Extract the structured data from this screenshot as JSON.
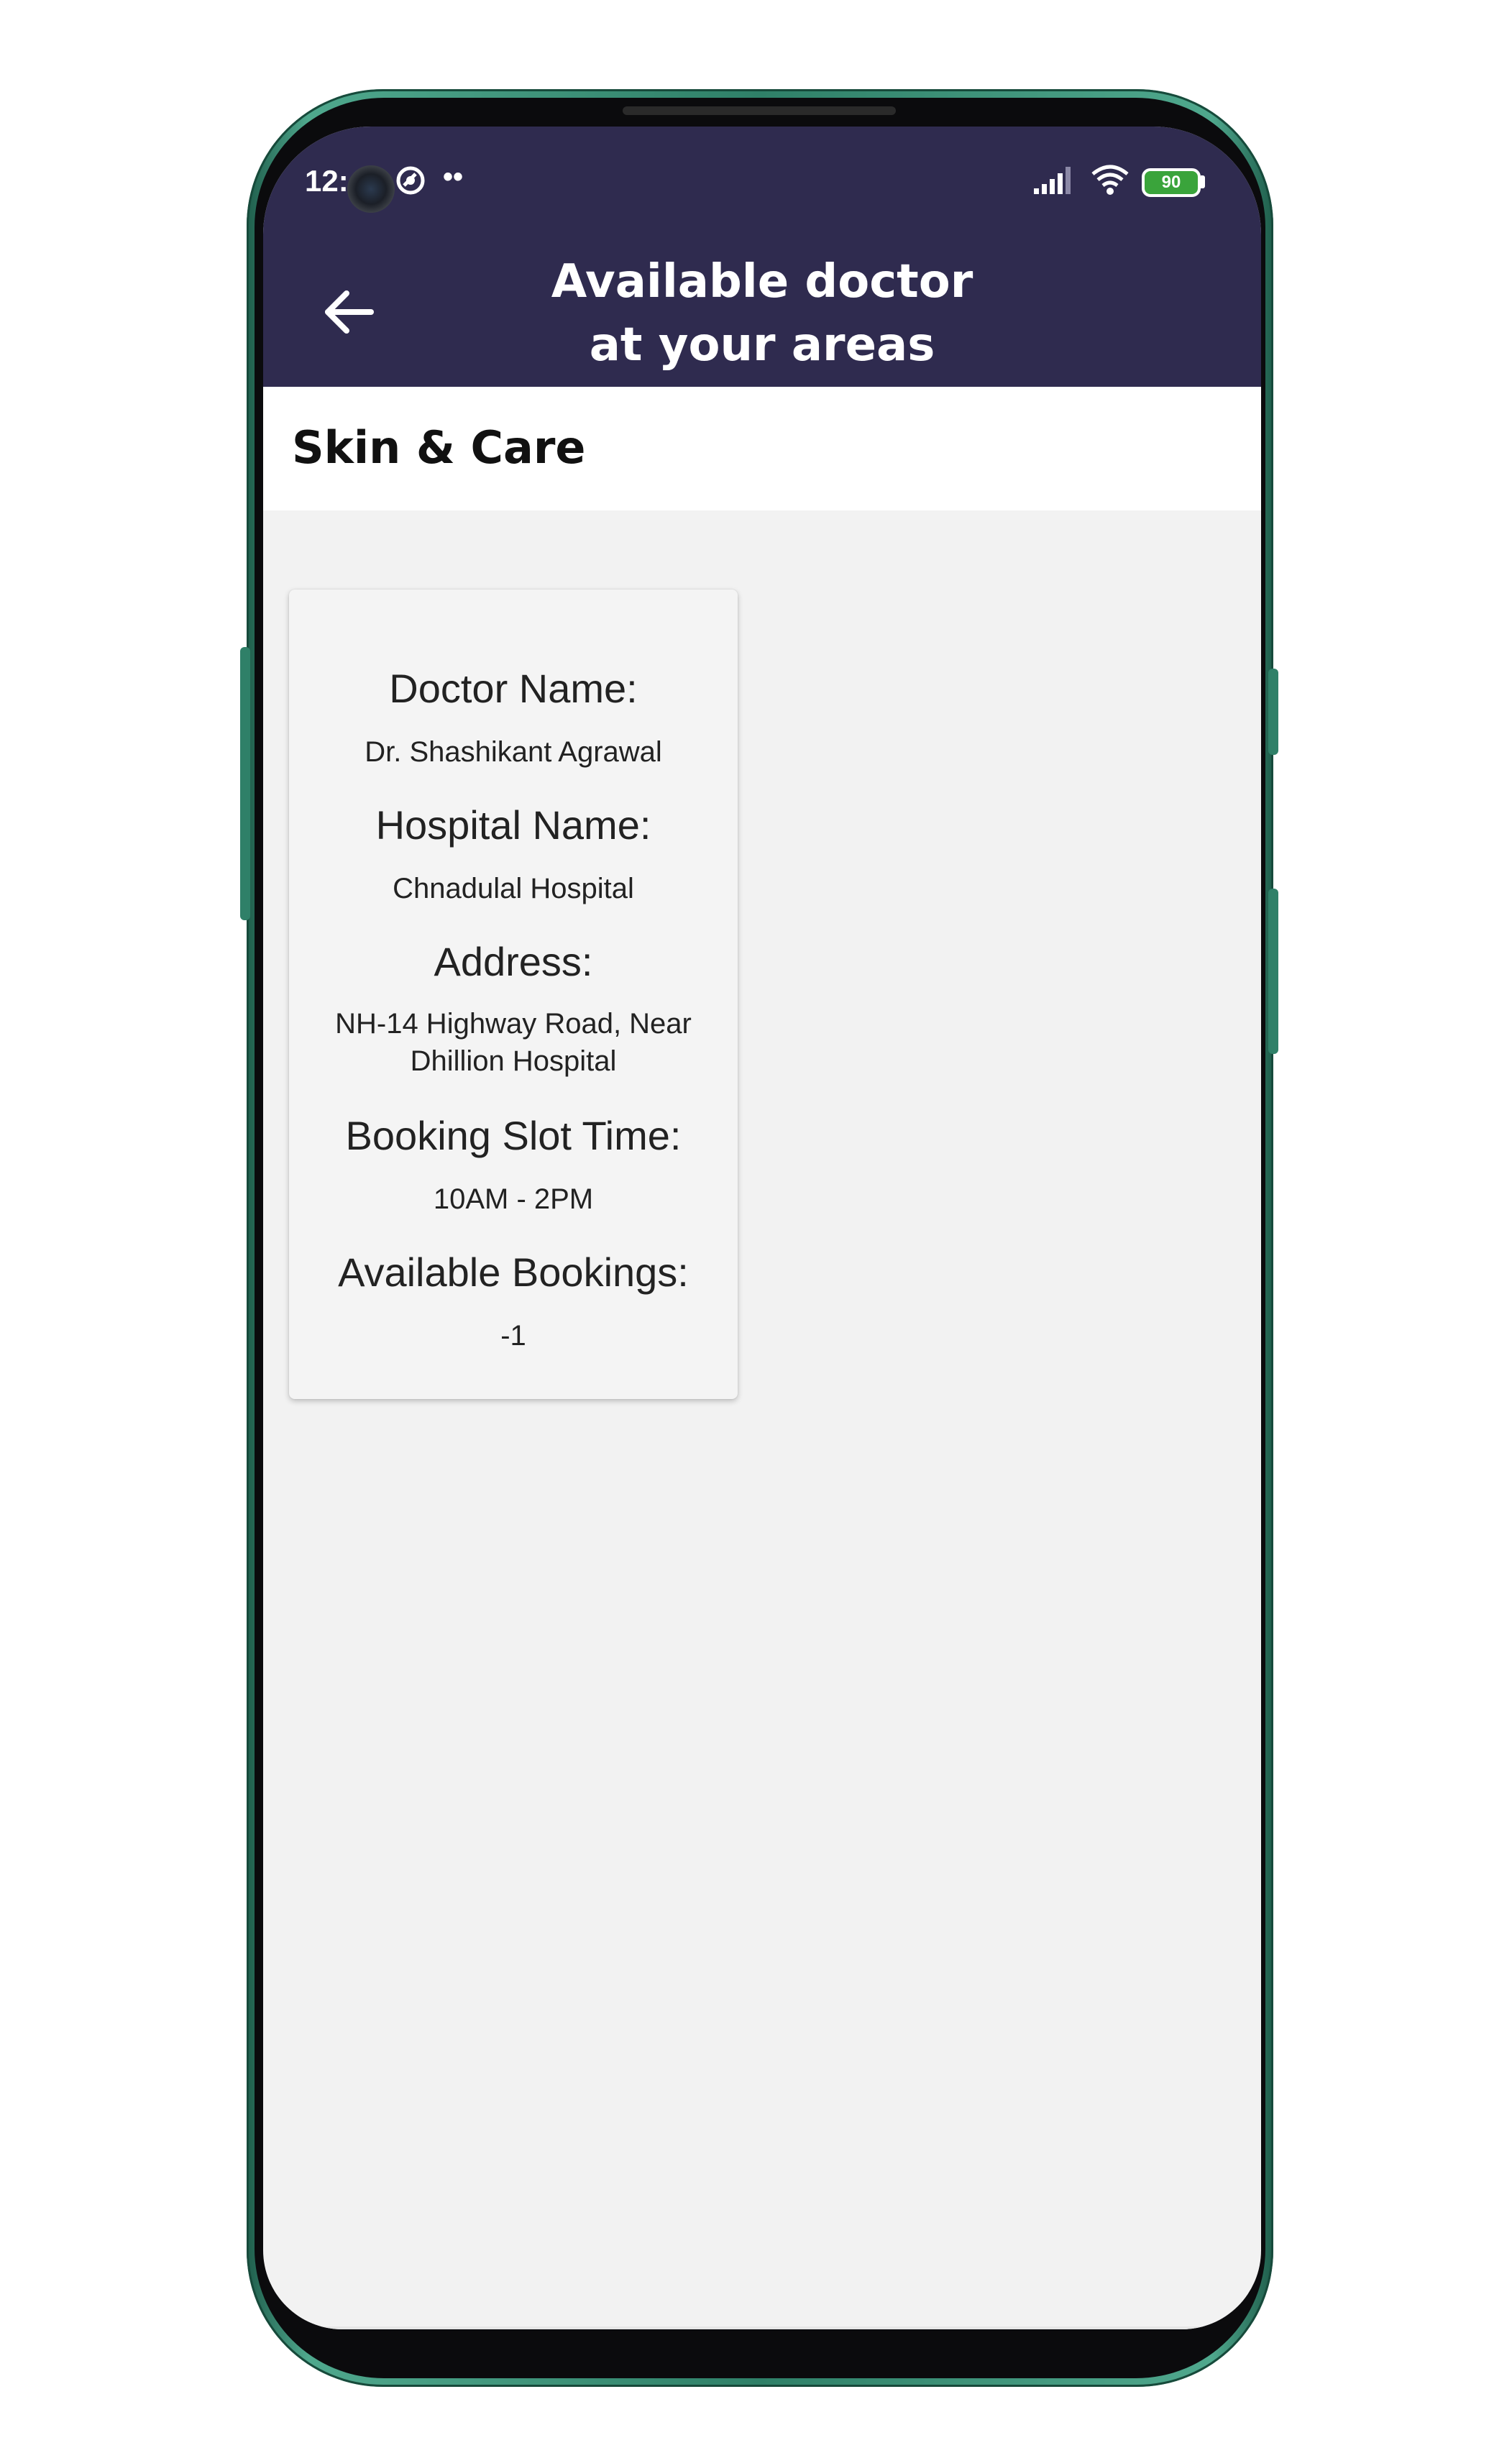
{
  "status_bar": {
    "time": "12:",
    "battery_level": "90",
    "signal_icon": "cellular-signal-icon",
    "wifi_icon": "wifi-icon",
    "extra_icon": "data-saver-icon",
    "more_dots": "••"
  },
  "header": {
    "title_line1": "Available doctor",
    "title_line2": "at your areas",
    "back_icon": "back-arrow-icon",
    "background_color": "#2f2b4f"
  },
  "category": {
    "title": "Skin & Care"
  },
  "doctor_card": {
    "doctor_name_label": "Doctor Name:",
    "doctor_name": "Dr. Shashikant Agrawal",
    "hospital_name_label": "Hospital Name:",
    "hospital_name": "Chnadulal Hospital",
    "address_label": "Address:",
    "address_line1": "NH-14 Highway Road, Near",
    "address_line2": "Dhillion Hospital",
    "booking_slot_label": "Booking Slot Time:",
    "booking_slot": "10AM - 2PM",
    "available_bookings_label": "Available Bookings:",
    "available_bookings": "-1"
  },
  "colors": {
    "app_bar": "#2f2b4f",
    "page_background": "#f2f2f2",
    "phone_frame": "#2f8068",
    "battery": "#3aa43b"
  }
}
